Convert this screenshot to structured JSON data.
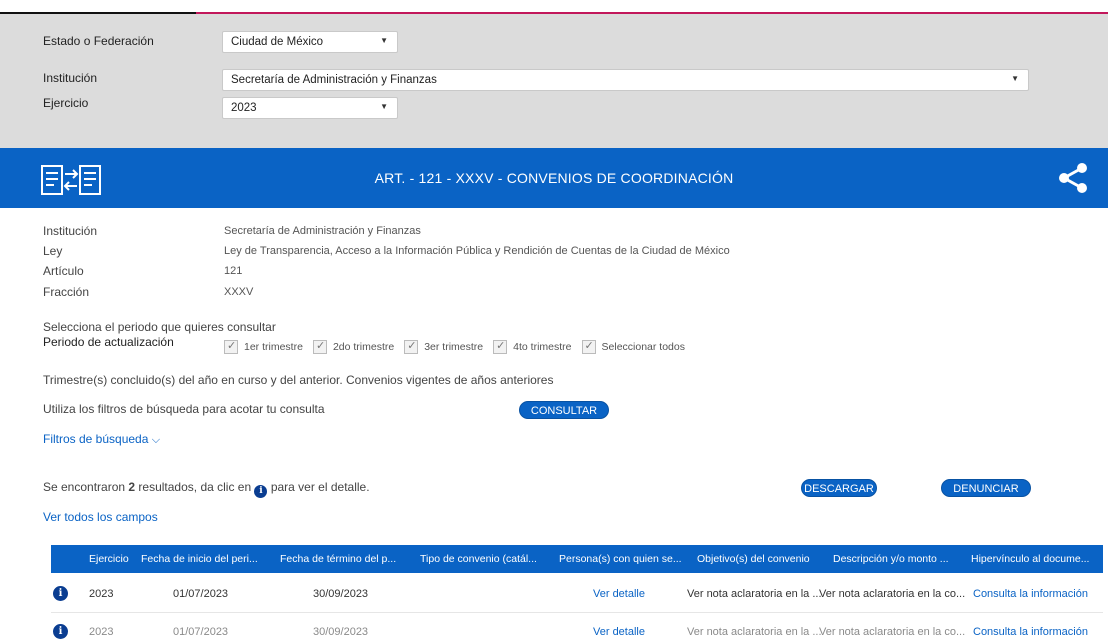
{
  "filters": {
    "estado_label": "Estado o Federación",
    "estado_value": "Ciudad de México",
    "institucion_label": "Institución",
    "institucion_value": "Secretaría de Administración y Finanzas",
    "ejercicio_label": "Ejercicio",
    "ejercicio_value": "2023"
  },
  "banner": {
    "title": "ART. - 121 - XXXV - CONVENIOS DE COORDINACIÓN",
    "logo_icon": "transfer-documents-icon",
    "share_icon": "share-icon"
  },
  "info": {
    "institucion_label": "Institución",
    "institucion_value": "Secretaría de Administración y Finanzas",
    "ley_label": "Ley",
    "ley_value": "Ley de Transparencia, Acceso a la Información Pública y Rendición de Cuentas de la Ciudad de México",
    "articulo_label": "Artículo",
    "articulo_value": "121",
    "fraccion_label": "Fracción",
    "fraccion_value": "XXXV"
  },
  "period": {
    "prompt": "Selecciona el periodo que quieres consultar",
    "label": "Periodo de actualización",
    "options": [
      "1er trimestre",
      "2do trimestre",
      "3er trimestre",
      "4to trimestre",
      "Seleccionar todos"
    ],
    "note": "Trimestre(s) concluido(s) del año en curso y del anterior. Convenios vigentes de años anteriores"
  },
  "search": {
    "hint": "Utiliza los filtros de búsqueda para acotar tu consulta",
    "consultar_label": "CONSULTAR",
    "filtros_label": "Filtros de búsqueda",
    "chevron_icon": "chevron-down-icon"
  },
  "results": {
    "prefix": "Se encontraron ",
    "count": "2",
    "middle": " resultados, da clic en ",
    "suffix": " para ver el detalle.",
    "descargar_label": "DESCARGAR",
    "denunciar_label": "DENUNCIAR",
    "ver_todos_label": "Ver todos los campos"
  },
  "table": {
    "headers": [
      "Ejercicio",
      "Fecha de inicio del peri...",
      "Fecha de término del p...",
      "Tipo de convenio (catál...",
      "Persona(s) con quien se...",
      "Objetivo(s) del convenio",
      "Descripción y/o monto ...",
      "Hipervínculo al docume..."
    ],
    "rows": [
      {
        "ejercicio": "2023",
        "inicio": "01/07/2023",
        "termino": "30/09/2023",
        "tipo": "",
        "persona": "Ver detalle",
        "objetivo": "Ver nota aclaratoria en la ...",
        "descripcion": "Ver nota aclaratoria en la co...",
        "hipervinculo": "Consulta la información"
      },
      {
        "ejercicio": "2023",
        "inicio": "01/07/2023",
        "termino": "30/09/2023",
        "tipo": "",
        "persona": "Ver detalle",
        "objetivo": "Ver nota aclaratoria en la ...",
        "descripcion": "Ver nota aclaratoria en la co...",
        "hipervinculo": "Consulta la información"
      }
    ]
  },
  "colors": {
    "primary_blue": "#0a63c5",
    "dark_blue_icon": "#0a3d91",
    "filter_bg": "#dcdcdc",
    "accent_pink": "#c2185b"
  }
}
